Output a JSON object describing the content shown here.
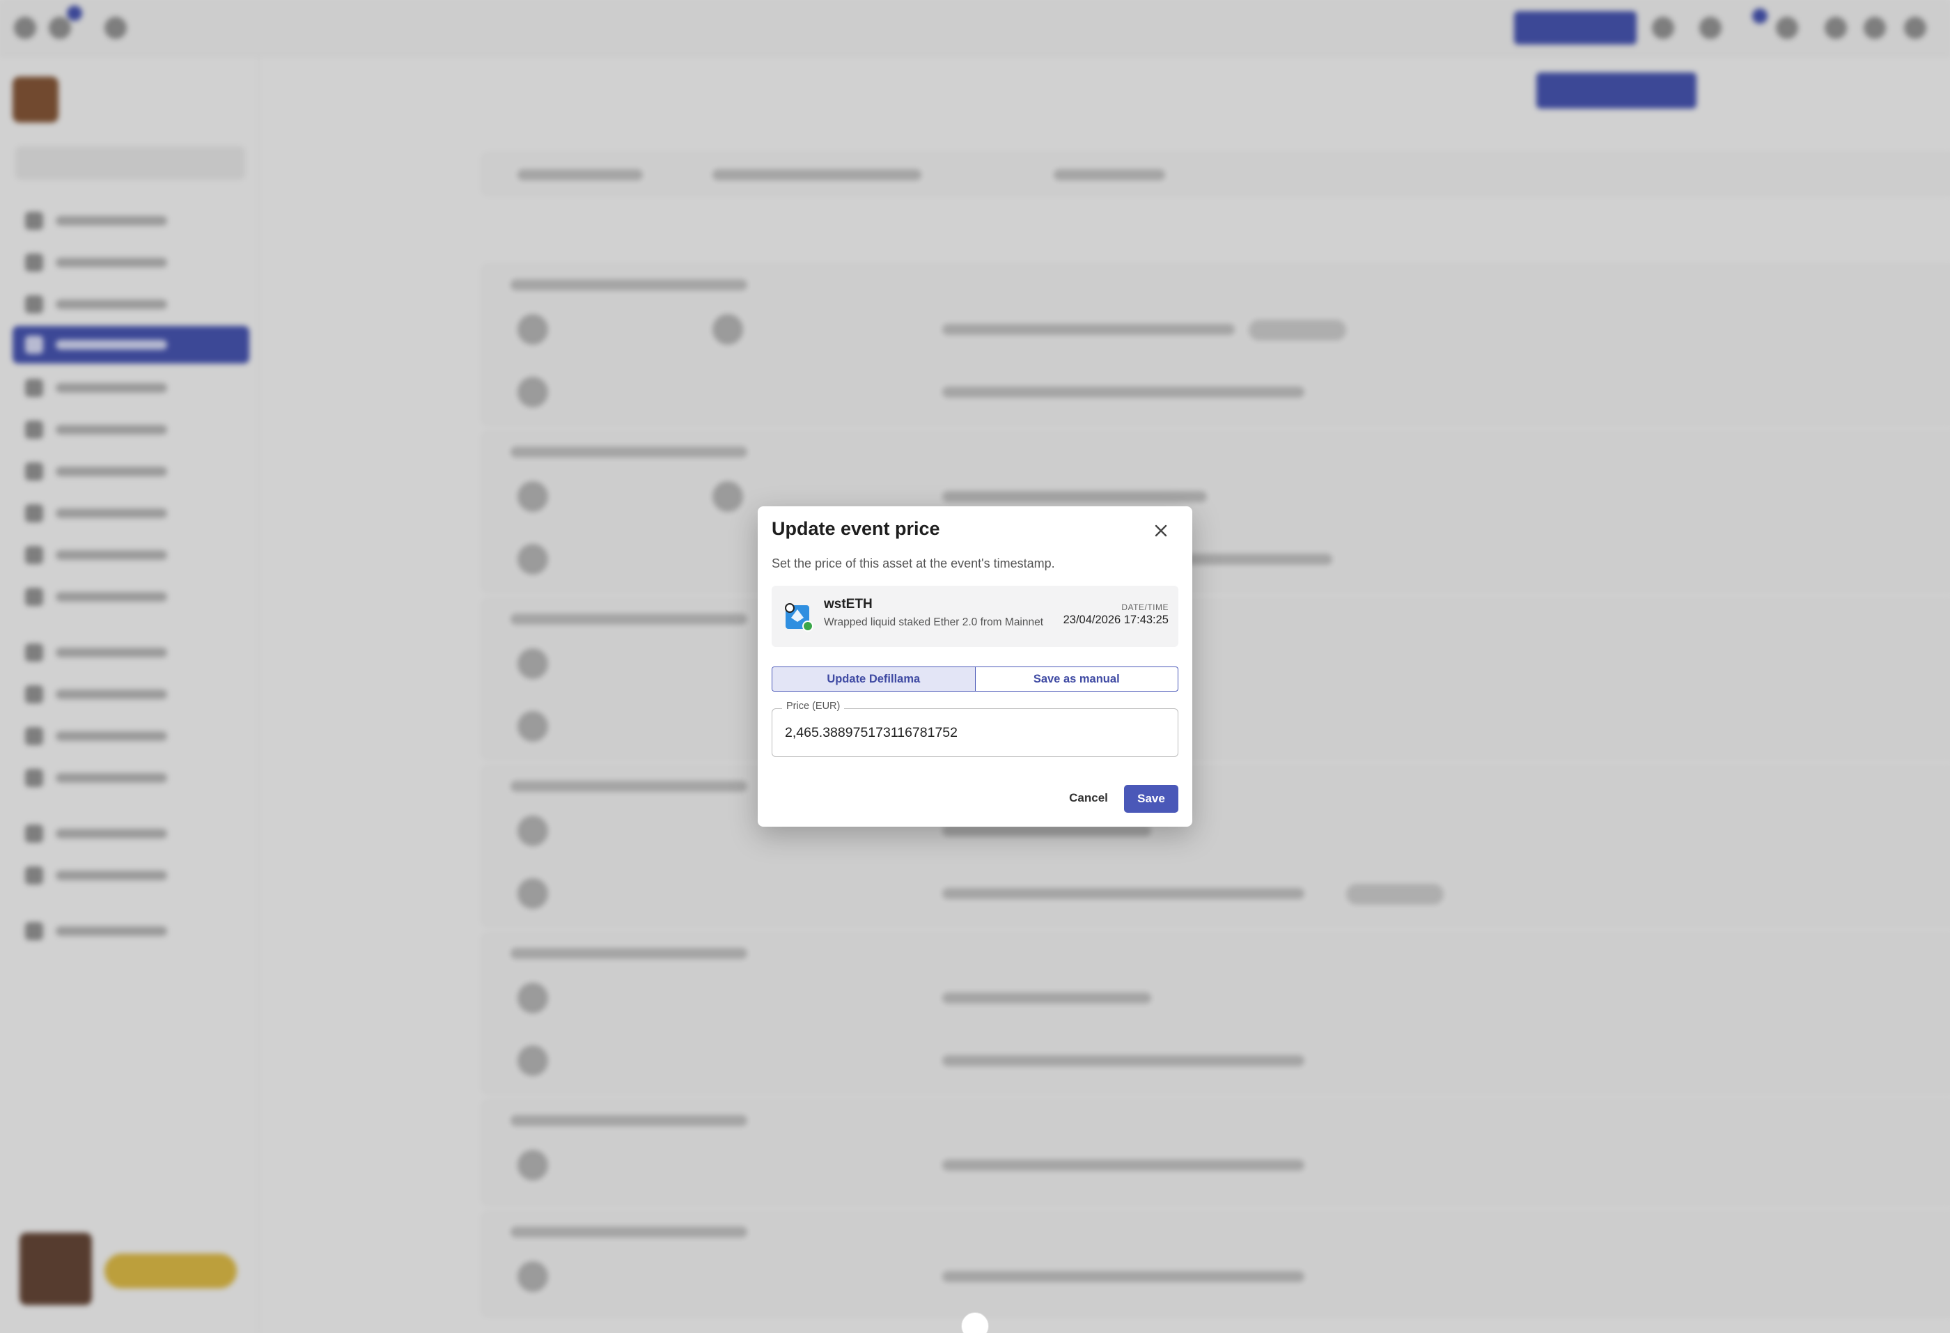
{
  "dialog": {
    "title": "Update event price",
    "close_icon": "close-icon",
    "description": "Set the price of this asset at the event's timestamp.",
    "asset": {
      "icon": "wsteth-asset-icon",
      "symbol": "wstETH",
      "name": "Wrapped liquid staked Ether 2.0 from Mainnet",
      "datetime_label": "DATE/TIME",
      "datetime_value": "23/04/2026 17:43:25"
    },
    "source_options": [
      {
        "label": "Update Defillama",
        "selected": true
      },
      {
        "label": "Save as manual",
        "selected": false
      }
    ],
    "price_field": {
      "label": "Price (EUR)",
      "value": "2,465.388975173116781752"
    },
    "cancel_label": "Cancel",
    "save_label": "Save"
  },
  "colors": {
    "accent": "#4a58b8",
    "accent_light": "#e3e5f6",
    "scrim": "rgba(0,0,0,0.18)"
  }
}
